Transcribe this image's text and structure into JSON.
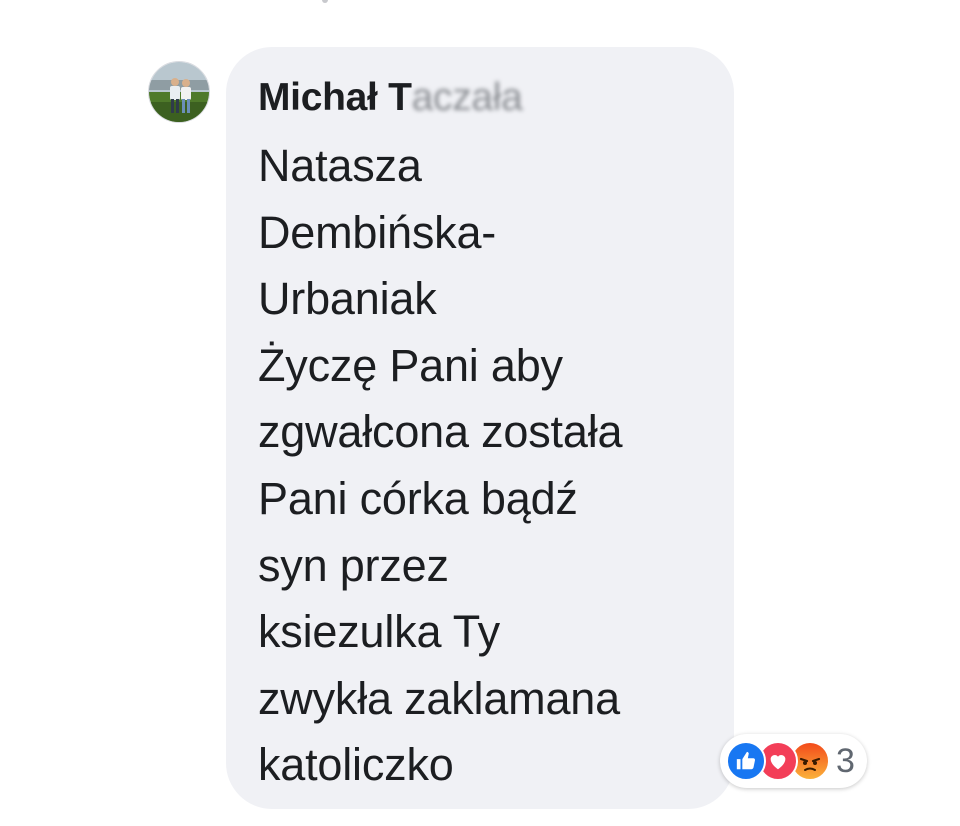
{
  "comment": {
    "author_visible": "Michał T",
    "author_obscured": "aczała",
    "message_lines": [
      "Natasza",
      "Dembińska-",
      "Urbaniak",
      "Życzę Pani aby",
      "zgwałcona została",
      "Pani córka bądź",
      "syn przez",
      "ksiezulka Ty",
      "zwykła zaklamana",
      "katoliczko"
    ]
  },
  "reactions": {
    "icons": [
      "like-icon",
      "love-icon",
      "angry-icon"
    ],
    "count": "3"
  },
  "colors": {
    "bubble_bg": "#f0f1f5",
    "text": "#1c1e21",
    "like": "#1877f2",
    "love": "#f33e58",
    "angry": "#f8872a",
    "count": "#606770"
  }
}
